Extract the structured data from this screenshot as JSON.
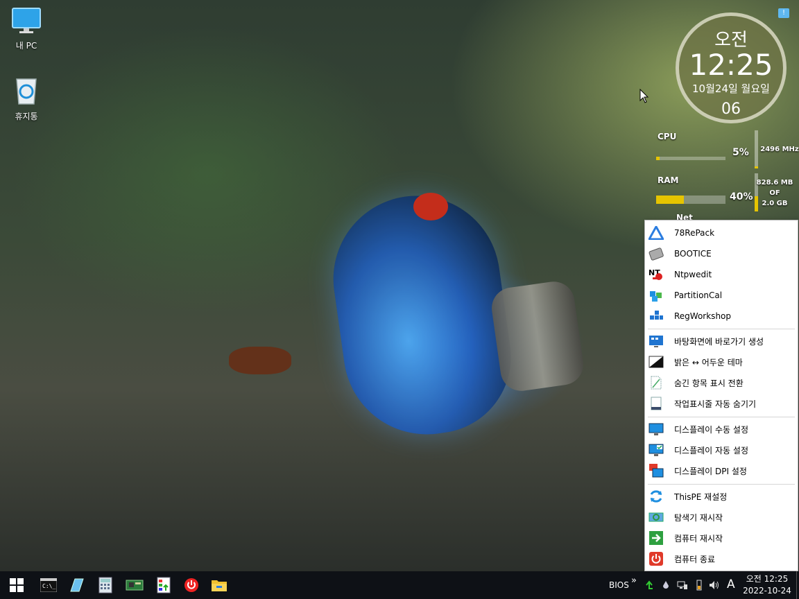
{
  "desktop": {
    "icons": [
      {
        "label": "내 PC",
        "icon": "monitor-icon"
      },
      {
        "label": "휴지통",
        "icon": "recycle-bin-icon"
      }
    ]
  },
  "clock_gadget": {
    "ampm": "오전",
    "time": "12:25",
    "date": "10월24일 월요일",
    "seconds": "06"
  },
  "monitor": {
    "cpu_label": "CPU",
    "cpu_percent": "5%",
    "cpu_freq": "2496 MHz",
    "cpu_value": 0.05,
    "ram_label": "RAM",
    "ram_percent": "40%",
    "ram_used": "828.6 MB",
    "ram_of": "OF",
    "ram_total": "2.0 GB",
    "ram_value": 0.4,
    "net_label": "Net",
    "accent_color": "#e6c400"
  },
  "context_menu": {
    "items": [
      {
        "label": "78RePack",
        "icon": "78repack-icon"
      },
      {
        "label": "BOOTICE",
        "icon": "bootice-icon"
      },
      {
        "label": "Ntpwedit",
        "icon": "ntpwedit-icon"
      },
      {
        "label": "PartitionCal",
        "icon": "partitioncal-icon"
      },
      {
        "label": "RegWorkshop",
        "icon": "regworkshop-icon"
      },
      {
        "label": "바탕화면에 바로가기 생성",
        "icon": "desktop-shortcut-icon"
      },
      {
        "label": "밝은 ↔ 어두운 테마",
        "icon": "theme-toggle-icon"
      },
      {
        "label": "숨긴 항목 표시 전환",
        "icon": "hidden-items-icon"
      },
      {
        "label": "작업표시줄 자동 숨기기",
        "icon": "taskbar-autohide-icon"
      },
      {
        "label": "디스플레이 수동 설정",
        "icon": "display-manual-icon"
      },
      {
        "label": "디스플레이 자동 설정",
        "icon": "display-auto-icon"
      },
      {
        "label": "디스플레이 DPI 설정",
        "icon": "display-dpi-icon"
      },
      {
        "label": "ThisPE 재설정",
        "icon": "refresh-icon"
      },
      {
        "label": "탐색기 재시작",
        "icon": "explorer-restart-icon"
      },
      {
        "label": "컴퓨터 재시작",
        "icon": "restart-arrow-icon"
      },
      {
        "label": "컴퓨터 종료",
        "icon": "power-off-icon"
      }
    ]
  },
  "taskbar": {
    "pinned": [
      {
        "icon": "start-windows-icon"
      },
      {
        "icon": "command-prompt-icon"
      },
      {
        "icon": "eraser-icon"
      },
      {
        "icon": "calculator-icon"
      },
      {
        "icon": "hardware-board-icon"
      },
      {
        "icon": "task-manager-icon"
      },
      {
        "icon": "power-button-icon"
      },
      {
        "icon": "file-explorer-icon"
      }
    ],
    "tray_bios": "BIOS",
    "tray_chevron": "»",
    "tray_ime": "A",
    "tray_time": "오전 12:25",
    "tray_date": "2022-10-24"
  }
}
